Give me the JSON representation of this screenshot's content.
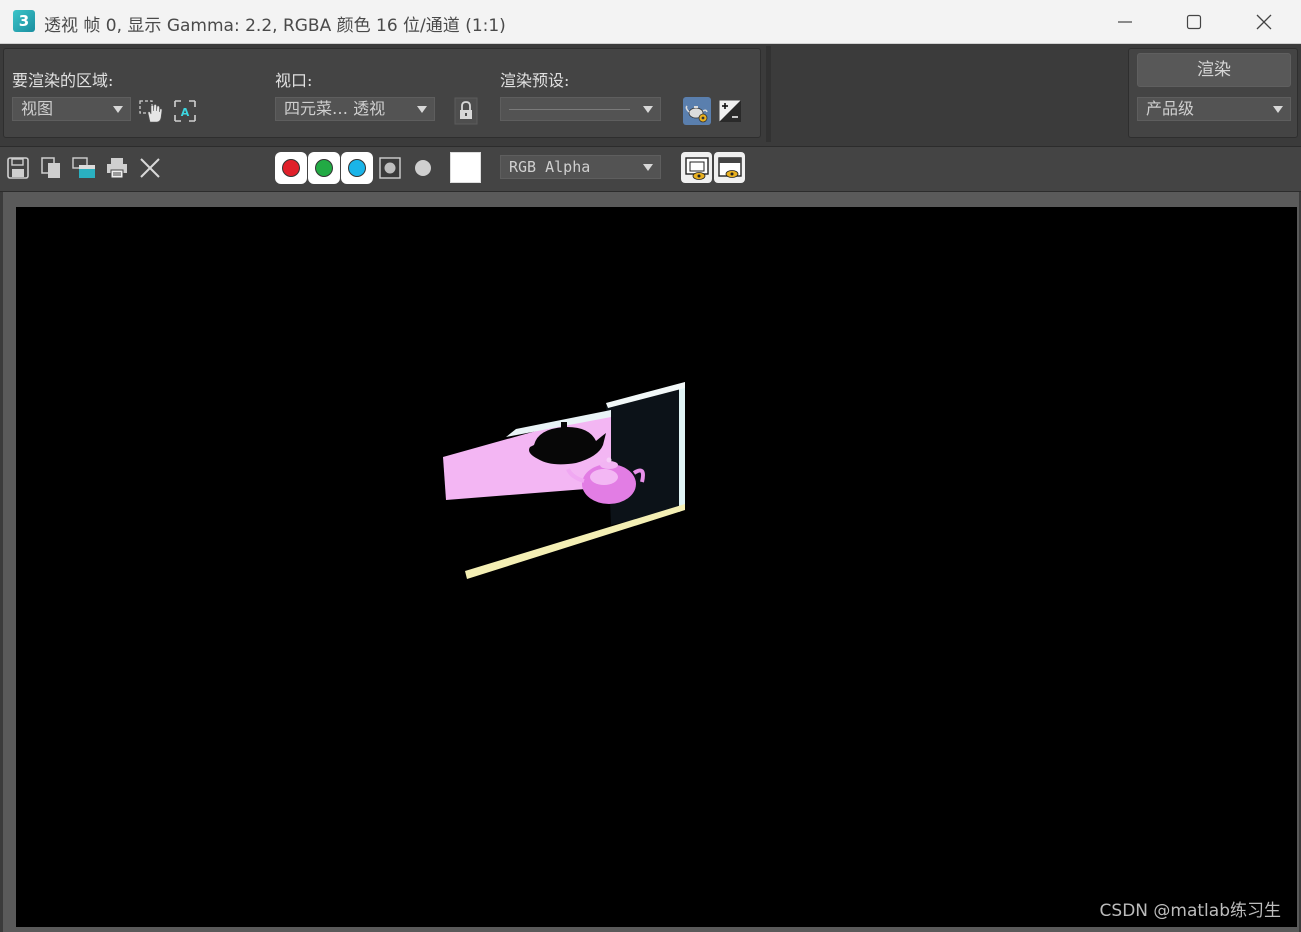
{
  "window": {
    "app_icon_text": "3",
    "title": "透视 帧 0, 显示 Gamma: 2.2, RGBA 颜色 16 位/通道 (1:1)"
  },
  "render_setup": {
    "area_label": "要渲染的区域:",
    "area_value": "视图",
    "viewport_label": "视口:",
    "viewport_value": "四元菜… 透视",
    "preset_label": "渲染预设:",
    "preset_value": "",
    "render_button": "渲染",
    "quality_value": "产品级"
  },
  "toolbar": {
    "channel_value": "RGB Alpha",
    "channels": [
      {
        "name": "red",
        "color": "#e0202a",
        "active": true
      },
      {
        "name": "green",
        "color": "#22aa44",
        "active": true
      },
      {
        "name": "blue",
        "color": "#1ab4e8",
        "active": true
      },
      {
        "name": "alpha",
        "color": "#bdbdbd",
        "active": false
      },
      {
        "name": "mono",
        "color": "#cfcfcf",
        "active": false
      }
    ]
  },
  "viewport": {
    "background_color": "#000000",
    "watermark": "CSDN @matlab练习生"
  }
}
